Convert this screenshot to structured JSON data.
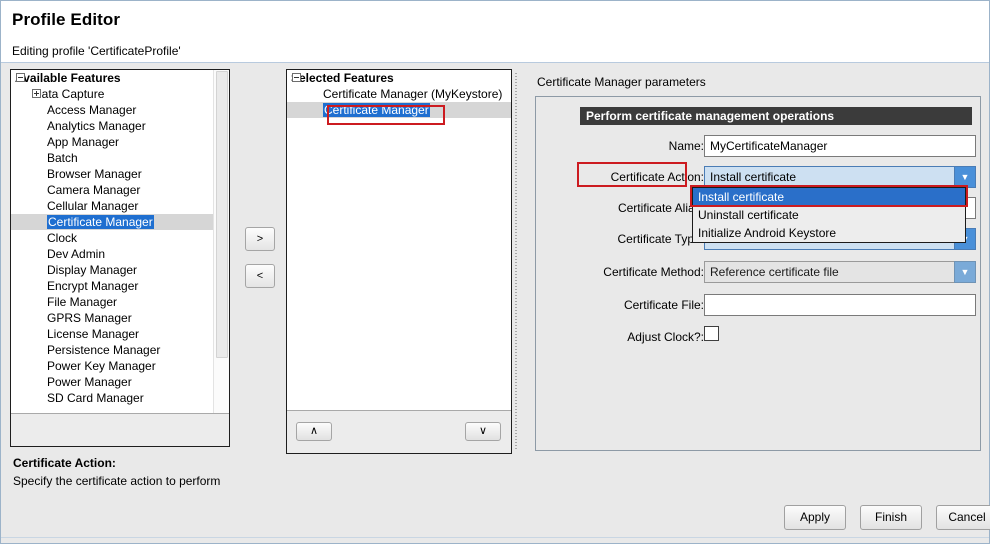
{
  "header": {
    "title": "Profile Editor",
    "subtitle": "Editing profile 'CertificateProfile'"
  },
  "available": {
    "root_label": "Available Features",
    "items": [
      {
        "label": "Data Capture",
        "type": "expandable"
      },
      {
        "label": "Access Manager",
        "type": "leaf"
      },
      {
        "label": "Analytics Manager",
        "type": "leaf"
      },
      {
        "label": "App Manager",
        "type": "leaf"
      },
      {
        "label": "Batch",
        "type": "leaf"
      },
      {
        "label": "Browser Manager",
        "type": "leaf"
      },
      {
        "label": "Camera Manager",
        "type": "leaf"
      },
      {
        "label": "Cellular Manager",
        "type": "leaf"
      },
      {
        "label": "Certificate Manager",
        "type": "leaf",
        "selected": true
      },
      {
        "label": "Clock",
        "type": "leaf"
      },
      {
        "label": "Dev Admin",
        "type": "leaf"
      },
      {
        "label": "Display Manager",
        "type": "leaf"
      },
      {
        "label": "Encrypt Manager",
        "type": "leaf"
      },
      {
        "label": "File Manager",
        "type": "leaf"
      },
      {
        "label": "GPRS Manager",
        "type": "leaf"
      },
      {
        "label": "License Manager",
        "type": "leaf"
      },
      {
        "label": "Persistence Manager",
        "type": "leaf"
      },
      {
        "label": "Power Key Manager",
        "type": "leaf"
      },
      {
        "label": "Power Manager",
        "type": "leaf"
      },
      {
        "label": "SD Card Manager",
        "type": "leaf"
      }
    ]
  },
  "transfer": {
    "add_label": ">",
    "remove_label": "<"
  },
  "selected": {
    "root_label": "Selected Features",
    "items": [
      {
        "label": "Certificate Manager (MyKeystore)",
        "selected": false
      },
      {
        "label": "Certificate Manager",
        "selected": true
      }
    ],
    "move_up_label": "∧",
    "move_down_label": "∨"
  },
  "parameters": {
    "panel_title": "Certificate Manager parameters",
    "group_header": "Perform certificate management operations",
    "fields": [
      {
        "label": "Name:",
        "kind": "text",
        "value": "MyCertificateManager"
      },
      {
        "label": "Certificate Action:",
        "kind": "combo",
        "value": "Install certificate",
        "state": "active",
        "highlighted": true
      },
      {
        "label": "Certificate Alias:",
        "kind": "text",
        "value": ""
      },
      {
        "label": "Certificate Type:",
        "kind": "combo",
        "value": "",
        "state": "active"
      },
      {
        "label": "Certificate Method:",
        "kind": "combo",
        "value": "Reference certificate file",
        "state": "inactive"
      },
      {
        "label": "Certificate File:",
        "kind": "text",
        "value": ""
      },
      {
        "label": "Adjust Clock?:",
        "kind": "checkbox",
        "checked": false
      }
    ],
    "dropdown": {
      "open": true,
      "options": [
        "Install certificate",
        "Uninstall certificate",
        "Initialize Android Keystore"
      ],
      "selected_index": 0
    }
  },
  "description": {
    "title": "Certificate Action:",
    "text": "Specify the certificate action to perform"
  },
  "buttons": {
    "apply": "Apply",
    "finish": "Finish",
    "cancel": "Cancel"
  },
  "colors": {
    "accent_blue": "#2a6fc9",
    "highlight_red": "#cc1b20",
    "combo_blue": "#4a90d9",
    "group_header_bg": "#3b3b3b"
  }
}
